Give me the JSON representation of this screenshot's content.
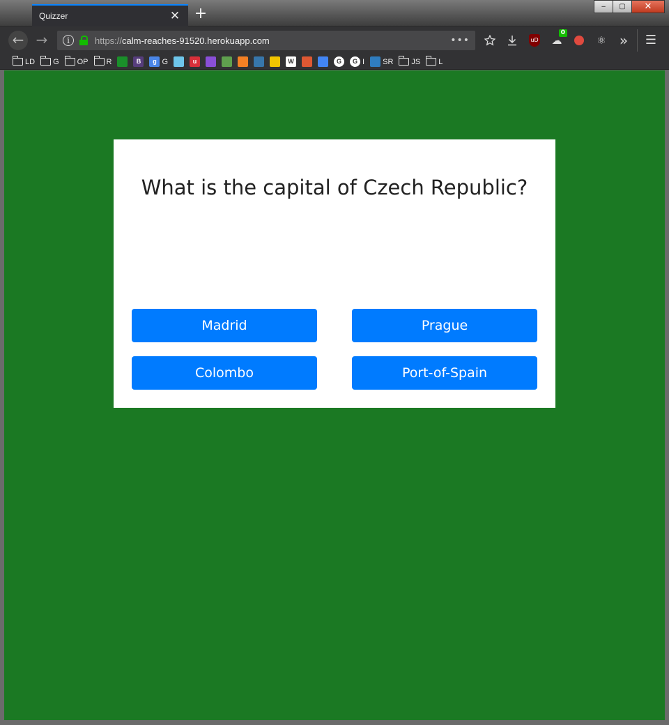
{
  "browser": {
    "tab_title": "Quizzer",
    "tab_close": "✕",
    "new_tab": "+",
    "window_controls": {
      "minimize": "‒",
      "maximize": "▢",
      "close": "✕"
    },
    "nav": {
      "back": "←",
      "forward": "→"
    },
    "url": {
      "protocol": "https://",
      "host": "calm-reaches-91520.herokuapp.com"
    },
    "url_more": "•••",
    "extension_badge": "0",
    "ublock_label": "uD",
    "overflow": "»",
    "menu": "☰",
    "bookmarks": [
      {
        "label": "LD",
        "icon": "folder-icon"
      },
      {
        "label": "G",
        "icon": "folder-icon"
      },
      {
        "label": "OP",
        "icon": "folder-icon"
      },
      {
        "label": "R",
        "icon": "folder-icon"
      },
      {
        "label": "",
        "icon": "android-icon",
        "color": "#1a8f2a"
      },
      {
        "label": "",
        "icon": "bootstrap-icon",
        "color": "#563d7c",
        "glyph": "B"
      },
      {
        "label": "G",
        "icon": "google-g-icon",
        "color": "#4a86e8",
        "glyph": "g"
      },
      {
        "label": "",
        "icon": "bird-icon",
        "color": "#6ec6ea"
      },
      {
        "label": "",
        "icon": "unsplash-icon",
        "color": "#d9303a",
        "glyph": "u"
      },
      {
        "label": "",
        "icon": "hexagon-icon",
        "color": "#8a4fd8"
      },
      {
        "label": "",
        "icon": "node-icon",
        "color": "#5fa04e"
      },
      {
        "label": "",
        "icon": "stackoverflow-icon",
        "color": "#f48024"
      },
      {
        "label": "",
        "icon": "python-icon",
        "color": "#3776ab"
      },
      {
        "label": "",
        "icon": "linux-icon",
        "color": "#f2c500"
      },
      {
        "label": "",
        "icon": "wikipedia-icon",
        "color": "#ffffff",
        "glyph": "W"
      },
      {
        "label": "",
        "icon": "duckduckgo-icon",
        "color": "#de5833"
      },
      {
        "label": "",
        "icon": "translate-icon",
        "color": "#4285f4"
      },
      {
        "label": "",
        "icon": "google-icon",
        "color": "#ffffff",
        "glyph": "G"
      },
      {
        "label": "I",
        "icon": "google-icon",
        "color": "#ffffff",
        "glyph": "G"
      },
      {
        "label": "SR",
        "icon": "bookmark-icon",
        "color": "#2f7dbf"
      },
      {
        "label": "JS",
        "icon": "folder-icon"
      },
      {
        "label": "L",
        "icon": "folder-icon"
      }
    ]
  },
  "quiz": {
    "question": "What is the capital of Czech Republic?",
    "answers": [
      "Madrid",
      "Prague",
      "Colombo",
      "Port-of-Spain"
    ],
    "colors": {
      "background": "#1b7923",
      "button": "#007bff",
      "card": "#ffffff"
    }
  }
}
